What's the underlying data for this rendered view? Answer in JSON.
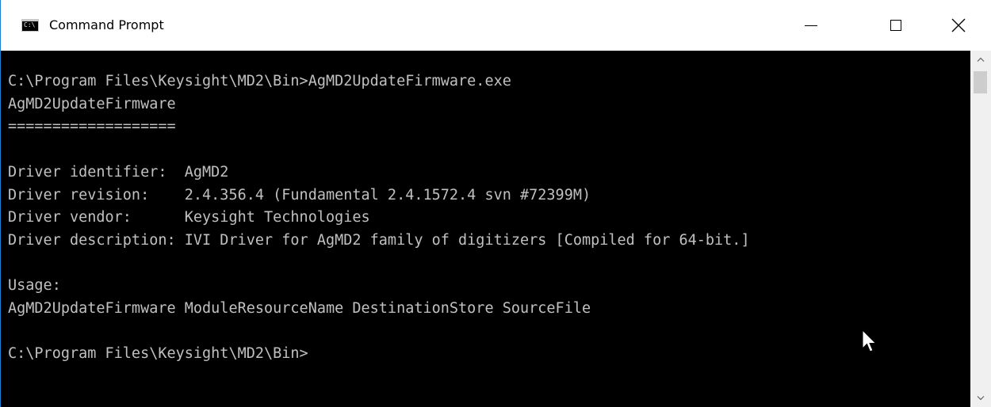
{
  "window": {
    "title": "Command Prompt",
    "app_icon_text": "C:\\"
  },
  "caption_buttons": {
    "minimize": "minimize",
    "maximize": "maximize",
    "close": "close"
  },
  "console": {
    "text_color": "#c0c0c0",
    "background_color": "#000000",
    "lines": [
      "C:\\Program Files\\Keysight\\MD2\\Bin>AgMD2UpdateFirmware.exe",
      "AgMD2UpdateFirmware",
      "===================",
      "",
      "Driver identifier:  AgMD2",
      "Driver revision:    2.4.356.4 (Fundamental 2.4.1572.4 svn #72399M)",
      "Driver vendor:      Keysight Technologies",
      "Driver description: IVI Driver for AgMD2 family of digitizers [Compiled for 64-bit.]",
      "",
      "Usage:",
      "AgMD2UpdateFirmware ModuleResourceName DestinationStore SourceFile",
      "",
      "C:\\Program Files\\Keysight\\MD2\\Bin>"
    ]
  },
  "scrollbar": {
    "up_icon": "chevron-up-icon",
    "down_icon": "chevron-down-icon"
  },
  "cursor": {
    "icon": "mouse-pointer-icon"
  }
}
